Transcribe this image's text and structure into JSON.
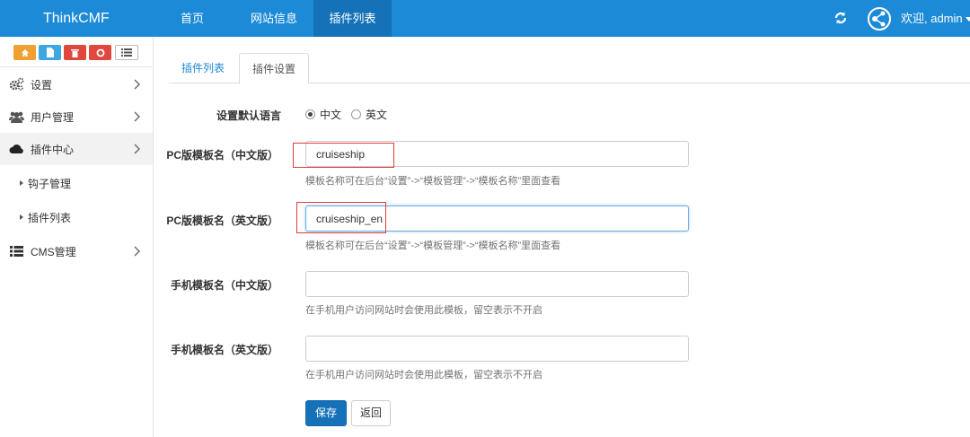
{
  "header": {
    "brand": "ThinkCMF",
    "nav": [
      {
        "label": "首页",
        "active": false
      },
      {
        "label": "网站信息",
        "active": false
      },
      {
        "label": "插件列表",
        "active": true
      }
    ],
    "user_label": "欢迎, admin",
    "icons": {
      "refresh": "refresh-icon",
      "avatar": "avatar-icon",
      "dropdown": "caret-down-icon"
    },
    "color": "#1c8ad6"
  },
  "sidebar": {
    "shortcuts": [
      "home-icon",
      "file-icon",
      "trash-icon",
      "recycle-icon",
      "list-icon"
    ],
    "items": [
      {
        "label": "设置",
        "icon": "cogs-icon"
      },
      {
        "label": "用户管理",
        "icon": "users-icon"
      },
      {
        "label": "插件中心",
        "icon": "cloud-icon",
        "active": true
      },
      {
        "label": "钩子管理",
        "sub": true
      },
      {
        "label": "插件列表",
        "sub": true
      },
      {
        "label": "CMS管理",
        "icon": "list-icon"
      }
    ]
  },
  "tabs": [
    {
      "label": "插件列表",
      "active": false
    },
    {
      "label": "插件设置",
      "active": true
    }
  ],
  "form": {
    "lang": {
      "label": "设置默认语言",
      "options": [
        {
          "label": "中文",
          "checked": true
        },
        {
          "label": "英文",
          "checked": false
        }
      ]
    },
    "fields": [
      {
        "label": "PC版模板名（中文版）",
        "value": "cruiseship",
        "placeholder": "",
        "help": "模板名称可在后台“设置”->“模板管理”->“模板名称”里面查看"
      },
      {
        "label": "PC版模板名（英文版）",
        "value": "cruiseship_en",
        "placeholder": "",
        "help": "模板名称可在后台“设置”->“模板管理”->“模板名称”里面查看"
      },
      {
        "label": "手机模板名（中文版）",
        "value": "",
        "placeholder": "",
        "help": "在手机用户访问网站时会使用此模板，留空表示不开启"
      },
      {
        "label": "手机模板名（英文版）",
        "value": "",
        "placeholder": "",
        "help": "在手机用户访问网站时会使用此模板，留空表示不开启"
      }
    ],
    "buttons": {
      "save": "保存",
      "back": "返回"
    }
  }
}
